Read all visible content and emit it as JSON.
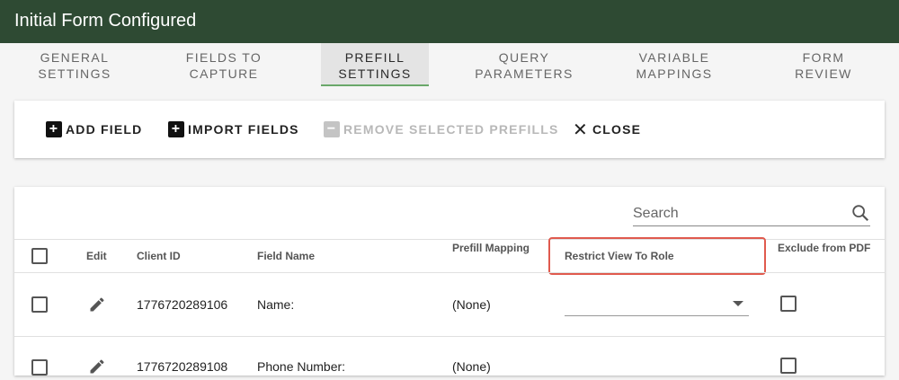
{
  "header": {
    "title": "Initial Form Configured"
  },
  "tabs": [
    {
      "line1": "GENERAL",
      "line2": "SETTINGS"
    },
    {
      "line1": "FIELDS TO",
      "line2": "CAPTURE"
    },
    {
      "line1": "PREFILL",
      "line2": "SETTINGS"
    },
    {
      "line1": "QUERY",
      "line2": "PARAMETERS"
    },
    {
      "line1": "VARIABLE",
      "line2": "MAPPINGS"
    },
    {
      "line1": "FORM",
      "line2": "REVIEW"
    }
  ],
  "toolbar": {
    "add_field": "ADD FIELD",
    "import_fields": "IMPORT FIELDS",
    "remove_selected": "REMOVE SELECTED PREFILLS",
    "close": "CLOSE"
  },
  "table": {
    "search_placeholder": "Search",
    "columns": {
      "edit": "Edit",
      "client_id": "Client ID",
      "field_name": "Field Name",
      "prefill_mapping": "Prefill Mapping",
      "restrict_view": "Restrict View To Role",
      "exclude_pdf": "Exclude from PDF"
    },
    "rows": [
      {
        "client_id": "1776720289106",
        "field_name": "Name:",
        "prefill_mapping": "(None)",
        "restrict_view": ""
      },
      {
        "client_id": "1776720289108",
        "field_name": "Phone Number:",
        "prefill_mapping": "(None)",
        "restrict_view": ""
      }
    ]
  },
  "colors": {
    "header_bg": "#2e4a33",
    "active_tab_underline": "#6aa86a",
    "highlight": "#e05a4e"
  }
}
